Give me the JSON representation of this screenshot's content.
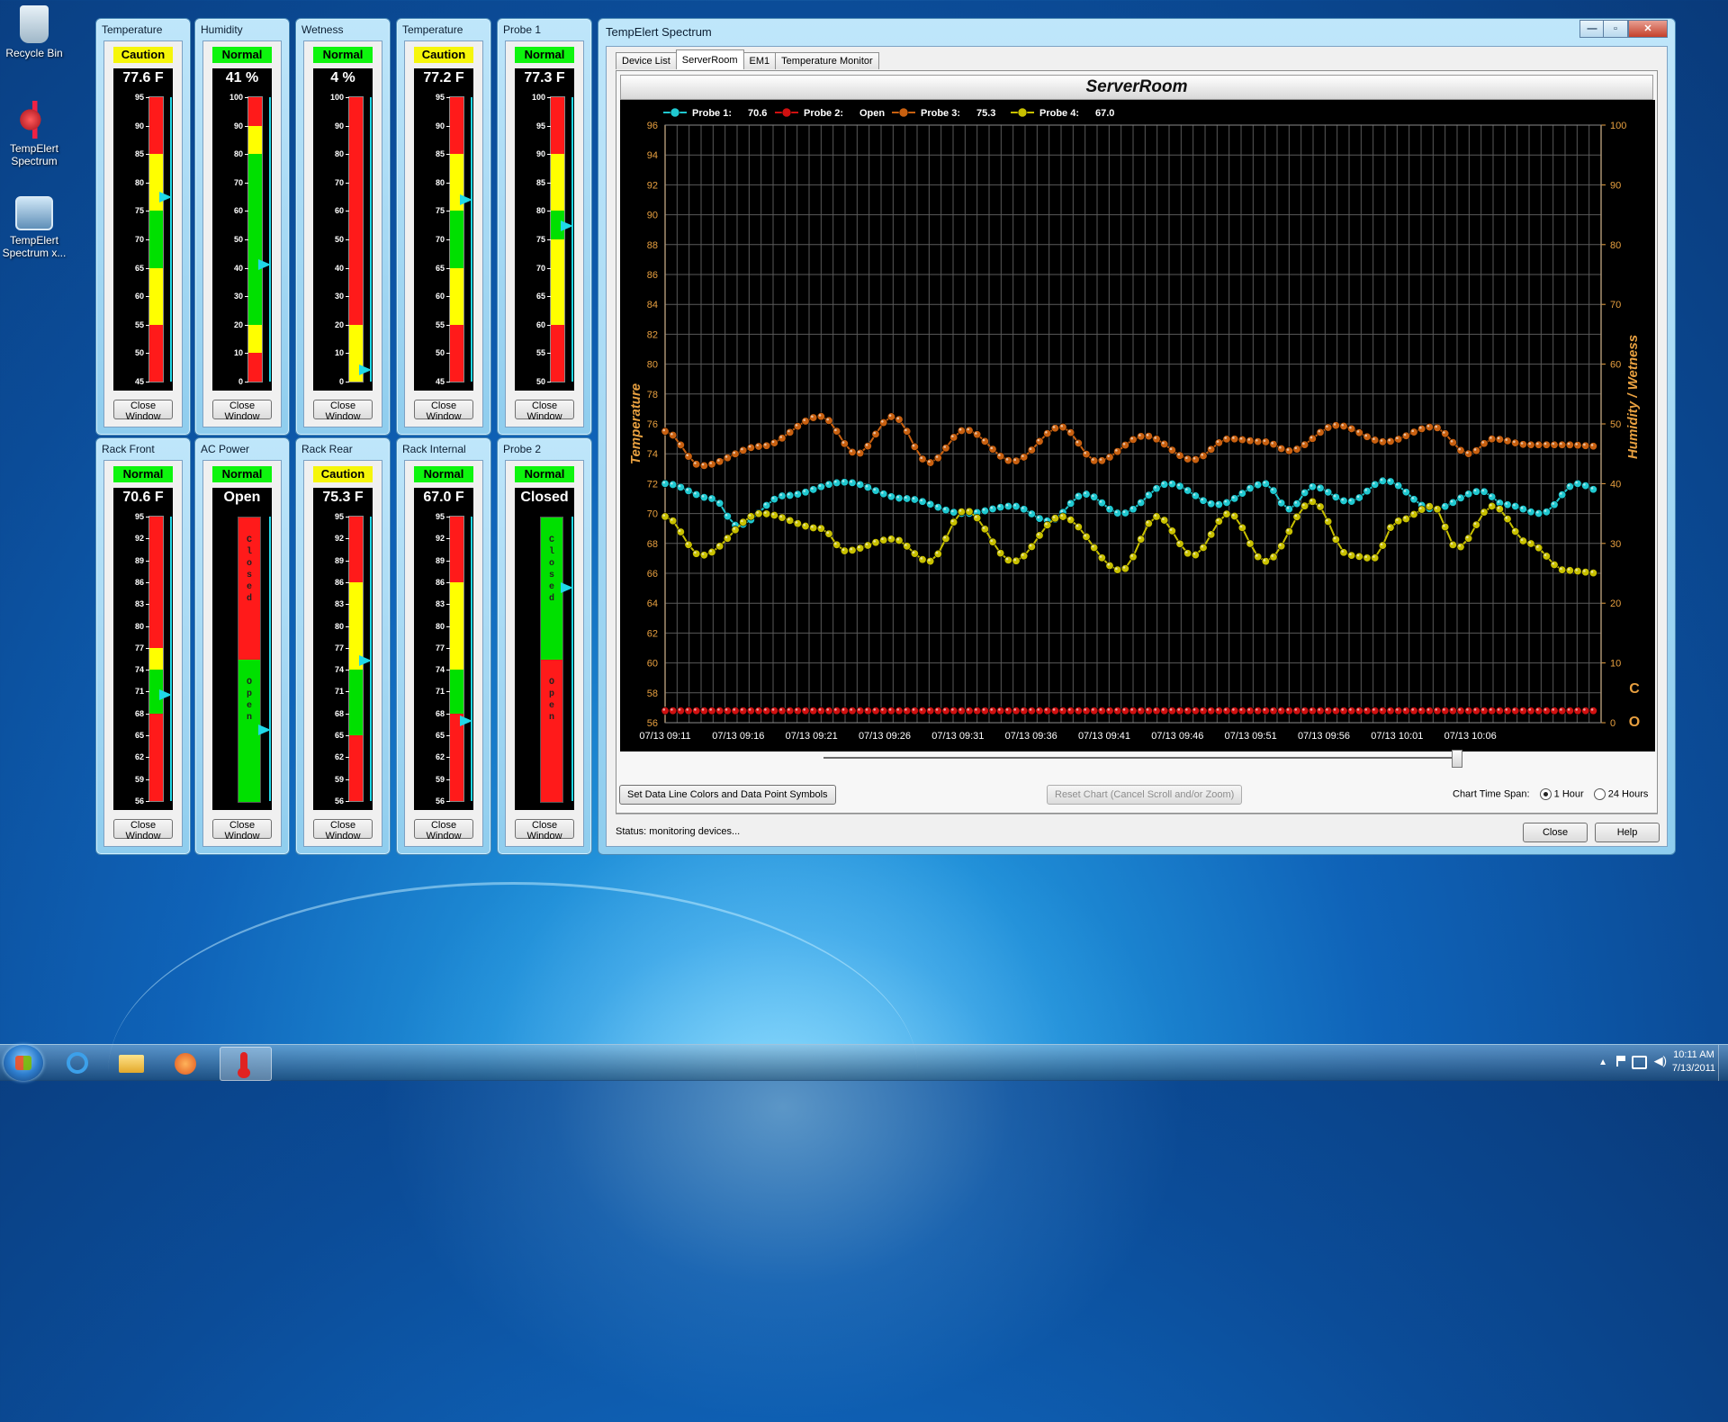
{
  "desktop": {
    "icons": [
      {
        "label": "Recycle Bin"
      },
      {
        "label": "TempElert Spectrum"
      },
      {
        "label": "TempElert Spectrum x..."
      }
    ]
  },
  "gauges": [
    {
      "title": "Temperature",
      "status": "Caution",
      "value": "77.6 F",
      "ticks": [
        "95",
        "90",
        "85",
        "80",
        "75",
        "70",
        "65",
        "60",
        "55",
        "50",
        "45"
      ],
      "pointer_fraction": 0.65,
      "colors": [
        "#ff1a1a",
        "#ff1a1a",
        "#ffff00",
        "#ffff00",
        "#00e000",
        "#00e000",
        "#ffff00",
        "#ffff00",
        "#ff1a1a",
        "#ff1a1a"
      ],
      "close_label": "Close Window"
    },
    {
      "title": "Humidity",
      "status": "Normal",
      "value": "41 %",
      "ticks": [
        "100",
        "90",
        "80",
        "70",
        "60",
        "50",
        "40",
        "30",
        "20",
        "10",
        "0"
      ],
      "pointer_fraction": 0.41,
      "colors": [
        "#ff1a1a",
        "#ffff00",
        "#00e000",
        "#00e000",
        "#00e000",
        "#00e000",
        "#00e000",
        "#00e000",
        "#ffff00",
        "#ff1a1a"
      ],
      "close_label": "Close Window"
    },
    {
      "title": "Wetness",
      "status": "Normal",
      "value": "4 %",
      "ticks": [
        "100",
        "90",
        "80",
        "70",
        "60",
        "50",
        "40",
        "30",
        "20",
        "10",
        "0"
      ],
      "pointer_fraction": 0.04,
      "colors": [
        "#ff1a1a",
        "#ff1a1a",
        "#ff1a1a",
        "#ff1a1a",
        "#ff1a1a",
        "#ff1a1a",
        "#ff1a1a",
        "#ff1a1a",
        "#ffff00",
        "#ffff00"
      ],
      "close_label": "Close Window"
    },
    {
      "title": "Temperature",
      "status": "Caution",
      "value": "77.2 F",
      "ticks": [
        "95",
        "90",
        "85",
        "80",
        "75",
        "70",
        "65",
        "60",
        "55",
        "50",
        "45"
      ],
      "pointer_fraction": 0.64,
      "colors": [
        "#ff1a1a",
        "#ff1a1a",
        "#ffff00",
        "#ffff00",
        "#00e000",
        "#00e000",
        "#ffff00",
        "#ffff00",
        "#ff1a1a",
        "#ff1a1a"
      ],
      "close_label": "Close Window"
    },
    {
      "title": "Probe 1",
      "status": "Normal",
      "value": "77.3 F",
      "ticks": [
        "100",
        "95",
        "90",
        "85",
        "80",
        "75",
        "70",
        "65",
        "60",
        "55",
        "50"
      ],
      "pointer_fraction": 0.546,
      "colors": [
        "#ff1a1a",
        "#ff1a1a",
        "#ffff00",
        "#ffff00",
        "#00e000",
        "#ffff00",
        "#ffff00",
        "#ffff00",
        "#ff1a1a",
        "#ff1a1a"
      ],
      "close_label": "Close Window"
    },
    {
      "title": "Rack Front",
      "status": "Normal",
      "value": "70.6 F",
      "ticks": [
        "95",
        "92",
        "89",
        "86",
        "83",
        "80",
        "77",
        "74",
        "71",
        "68",
        "65",
        "62",
        "59",
        "56"
      ],
      "pointer_fraction": 0.374,
      "colors": [
        "#ff1a1a",
        "#ff1a1a",
        "#ff1a1a",
        "#ff1a1a",
        "#ff1a1a",
        "#ff1a1a",
        "#ffff00",
        "#00e000",
        "#00e000",
        "#ff1a1a",
        "#ff1a1a",
        "#ff1a1a",
        "#ff1a1a"
      ],
      "close_label": "Close Window"
    },
    {
      "title": "AC Power",
      "status": "Normal",
      "value": "Open",
      "binary": true,
      "top_label": "Closed",
      "bottom_label": "Open",
      "top_color": "#ff1a1a",
      "bottom_color": "#00e000",
      "pointer_fraction": 0.25,
      "close_label": "Close Window"
    },
    {
      "title": "Rack Rear",
      "status": "Caution",
      "value": "75.3 F",
      "ticks": [
        "95",
        "92",
        "89",
        "86",
        "83",
        "80",
        "77",
        "74",
        "71",
        "68",
        "65",
        "62",
        "59",
        "56"
      ],
      "pointer_fraction": 0.495,
      "colors": [
        "#ff1a1a",
        "#ff1a1a",
        "#ff1a1a",
        "#ffff00",
        "#ffff00",
        "#ffff00",
        "#ffff00",
        "#00e000",
        "#00e000",
        "#00e000",
        "#ff1a1a",
        "#ff1a1a",
        "#ff1a1a"
      ],
      "close_label": "Close Window"
    },
    {
      "title": "Rack Internal",
      "status": "Normal",
      "value": "67.0 F",
      "ticks": [
        "95",
        "92",
        "89",
        "86",
        "83",
        "80",
        "77",
        "74",
        "71",
        "68",
        "65",
        "62",
        "59",
        "56"
      ],
      "pointer_fraction": 0.282,
      "colors": [
        "#ff1a1a",
        "#ff1a1a",
        "#ff1a1a",
        "#ffff00",
        "#ffff00",
        "#ffff00",
        "#ffff00",
        "#00e000",
        "#00e000",
        "#ff1a1a",
        "#ff1a1a",
        "#ff1a1a",
        "#ff1a1a"
      ],
      "close_label": "Close Window"
    },
    {
      "title": "Probe 2",
      "status": "Normal",
      "value": "Closed",
      "binary": true,
      "top_label": "Closed",
      "bottom_label": "Open",
      "top_color": "#00e000",
      "bottom_color": "#ff1a1a",
      "pointer_fraction": 0.75,
      "close_label": "Close Window"
    }
  ],
  "main": {
    "title": "TempElert Spectrum",
    "window_buttons": {
      "minimize": "—",
      "maximize": "▫",
      "close": "✕"
    },
    "tabs": [
      {
        "label": "Device List",
        "active": false
      },
      {
        "label": "ServerRoom",
        "active": true
      },
      {
        "label": "EM1",
        "active": false
      },
      {
        "label": "Temperature Monitor",
        "active": false
      }
    ],
    "chart_header": "ServerRoom",
    "buttons": {
      "set_colors": "Set Data Line Colors and Data Point Symbols",
      "reset_chart": "Reset Chart (Cancel Scroll and/or Zoom)",
      "close": "Close",
      "help": "Help"
    },
    "timespan": {
      "label": "Chart Time Span:",
      "options": [
        {
          "label": "1 Hour",
          "selected": true
        },
        {
          "label": "24 Hours",
          "selected": false
        }
      ]
    },
    "status": "Status: monitoring devices..."
  },
  "chart_data": {
    "type": "line",
    "ylabel": "Temperature",
    "y2label": "Humidity / Wetness",
    "ylim": [
      56,
      96
    ],
    "y2lim": [
      0,
      100
    ],
    "yticks": [
      "96",
      "94",
      "92",
      "90",
      "88",
      "86",
      "84",
      "82",
      "80",
      "78",
      "76",
      "74",
      "72",
      "70",
      "68",
      "66",
      "64",
      "62",
      "60",
      "58",
      "56"
    ],
    "y2ticks": [
      "100",
      "90",
      "80",
      "70",
      "60",
      "50",
      "40",
      "30",
      "20",
      "10",
      "0"
    ],
    "xticks": [
      "07/13 09:11",
      "07/13 09:16",
      "07/13 09:21",
      "07/13 09:26",
      "07/13 09:31",
      "07/13 09:36",
      "07/13 09:41",
      "07/13 09:46",
      "07/13 09:51",
      "07/13 09:56",
      "07/13 10:01",
      "07/13 10:06"
    ],
    "xlim_minutes": [
      0,
      61
    ],
    "co_labels": [
      "C",
      "O"
    ],
    "grid": true,
    "legend_placement": "top-left",
    "series": [
      {
        "name": "Probe 1:",
        "legend_value": "70.6",
        "color": "#20c8d0",
        "axis": "left",
        "points": [
          [
            0,
            72.0
          ],
          [
            4,
            71.0
          ],
          [
            6,
            69.2
          ],
          [
            10,
            71.2
          ],
          [
            15,
            72.1
          ],
          [
            20,
            71.0
          ],
          [
            25,
            70.0
          ],
          [
            29,
            70.5
          ],
          [
            32,
            69.5
          ],
          [
            35,
            71.3
          ],
          [
            38,
            70.0
          ],
          [
            42,
            72.0
          ],
          [
            46,
            70.6
          ],
          [
            50,
            72.0
          ],
          [
            52,
            70.3
          ],
          [
            54,
            71.8
          ],
          [
            57,
            70.8
          ],
          [
            60,
            72.2
          ],
          [
            64,
            70.3
          ],
          [
            68,
            71.5
          ],
          [
            70,
            70.6
          ],
          [
            73,
            70.0
          ],
          [
            76,
            72.0
          ],
          [
            78,
            71.5
          ]
        ]
      },
      {
        "name": "Probe 2:",
        "legend_value": "Open",
        "color": "#d01010",
        "axis": "binary",
        "points": [
          [
            0,
            56.8
          ],
          [
            78,
            56.8
          ]
        ]
      },
      {
        "name": "Probe 3:",
        "legend_value": "75.3",
        "color": "#c86010",
        "axis": "left",
        "points": [
          [
            0,
            75.5
          ],
          [
            3,
            73.2
          ],
          [
            8,
            74.5
          ],
          [
            13,
            76.5
          ],
          [
            16,
            74.0
          ],
          [
            19,
            76.5
          ],
          [
            22,
            73.4
          ],
          [
            25,
            75.6
          ],
          [
            29,
            73.5
          ],
          [
            33,
            75.8
          ],
          [
            36,
            73.5
          ],
          [
            40,
            75.2
          ],
          [
            44,
            73.6
          ],
          [
            47,
            75.0
          ],
          [
            50,
            74.8
          ],
          [
            52,
            74.2
          ],
          [
            56,
            75.9
          ],
          [
            60,
            74.8
          ],
          [
            64,
            75.8
          ],
          [
            67,
            74.0
          ],
          [
            69,
            75.0
          ],
          [
            72,
            74.6
          ],
          [
            75,
            74.6
          ],
          [
            78,
            74.5
          ]
        ]
      },
      {
        "name": "Probe 4:",
        "legend_value": "67.0",
        "color": "#c8c000",
        "axis": "left",
        "points": [
          [
            0,
            69.8
          ],
          [
            3,
            67.2
          ],
          [
            8,
            70.0
          ],
          [
            13,
            69.0
          ],
          [
            15,
            67.5
          ],
          [
            19,
            68.3
          ],
          [
            22,
            66.8
          ],
          [
            25,
            70.2
          ],
          [
            29,
            66.8
          ],
          [
            33,
            69.8
          ],
          [
            38,
            66.2
          ],
          [
            41,
            69.8
          ],
          [
            44,
            67.2
          ],
          [
            47,
            70.0
          ],
          [
            50,
            66.8
          ],
          [
            54,
            70.8
          ],
          [
            57,
            67.2
          ],
          [
            59,
            67.0
          ],
          [
            61,
            69.5
          ],
          [
            64,
            70.5
          ],
          [
            66,
            67.7
          ],
          [
            69,
            70.5
          ],
          [
            72,
            68.0
          ],
          [
            75,
            66.2
          ],
          [
            78,
            66.0
          ]
        ]
      }
    ]
  },
  "taskbar": {
    "clock_time": "10:11 AM",
    "clock_date": "7/13/2011"
  }
}
